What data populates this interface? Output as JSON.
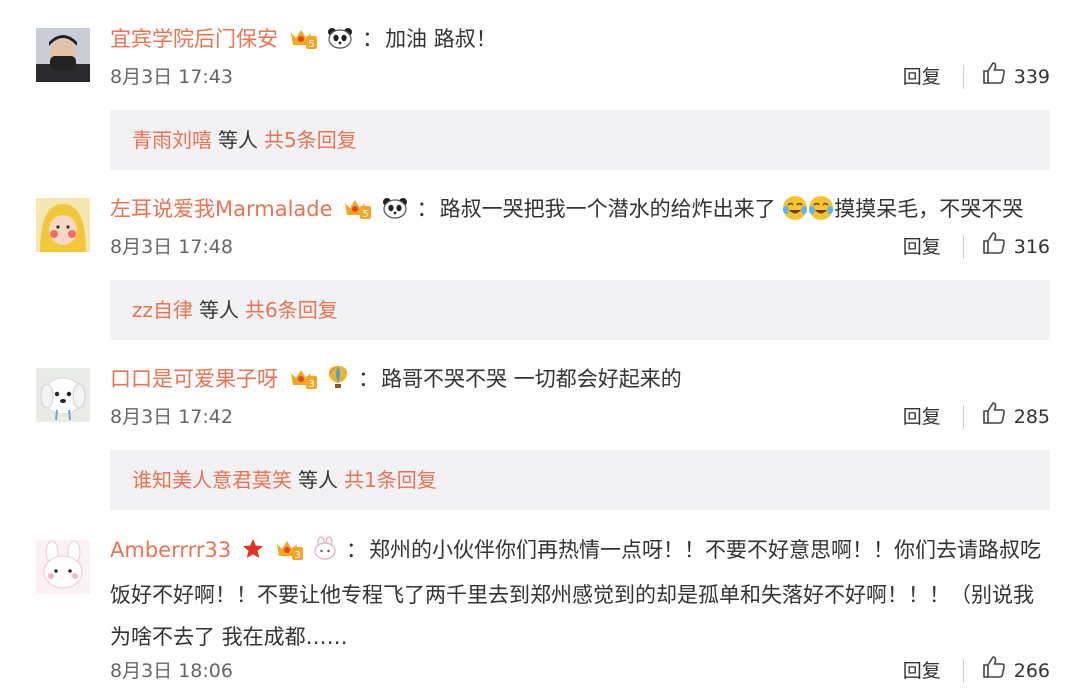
{
  "comments": [
    {
      "user": "宜宾学院后门保安",
      "badge": "5",
      "text": "加油 路叔！",
      "date": "8月3日 17:43",
      "reply_label": "回复",
      "likes": "339",
      "replies": {
        "name": "青雨刘嘻",
        "tail": "等人",
        "count": "共5条回复"
      }
    },
    {
      "user": "左耳说爱我Marmalade",
      "badge": "5",
      "text": "路叔一哭把我一个潜水的给炸出来了",
      "text2": "摸摸呆毛，不哭不哭",
      "date": "8月3日 17:48",
      "reply_label": "回复",
      "likes": "316",
      "replies": {
        "name": "zz自律",
        "tail": "等人",
        "count": "共6条回复"
      }
    },
    {
      "user": "口口是可爱果子呀",
      "badge": "3",
      "text": "路哥不哭不哭 一切都会好起来的",
      "date": "8月3日 17:42",
      "reply_label": "回复",
      "likes": "285",
      "replies": {
        "name": "谁知美人意君莫笑",
        "tail": "等人",
        "count": "共1条回复"
      }
    },
    {
      "user": "Amberrrr33",
      "badge": "3",
      "text": "郑州的小伙伴你们再热情一点呀！！不要不好意思啊！！你们去请路叔吃饭好不好啊！！不要让他专程飞了两千里去到郑州感觉到的却是孤单和失落好不好啊！！！（别说我为啥不去了 我在成都……",
      "date": "8月3日 18:06",
      "reply_label": "回复",
      "likes": "266"
    }
  ],
  "colors": {
    "username": "#eb7350",
    "reply_bg": "#f2f2f5",
    "meta": "#666666"
  },
  "icons": [
    "avatar",
    "vip-crown-badge",
    "panda-icon",
    "balloon-icon",
    "bunny-icon",
    "star-icon",
    "crying-laugh-emoji",
    "thumbs-up-icon"
  ]
}
